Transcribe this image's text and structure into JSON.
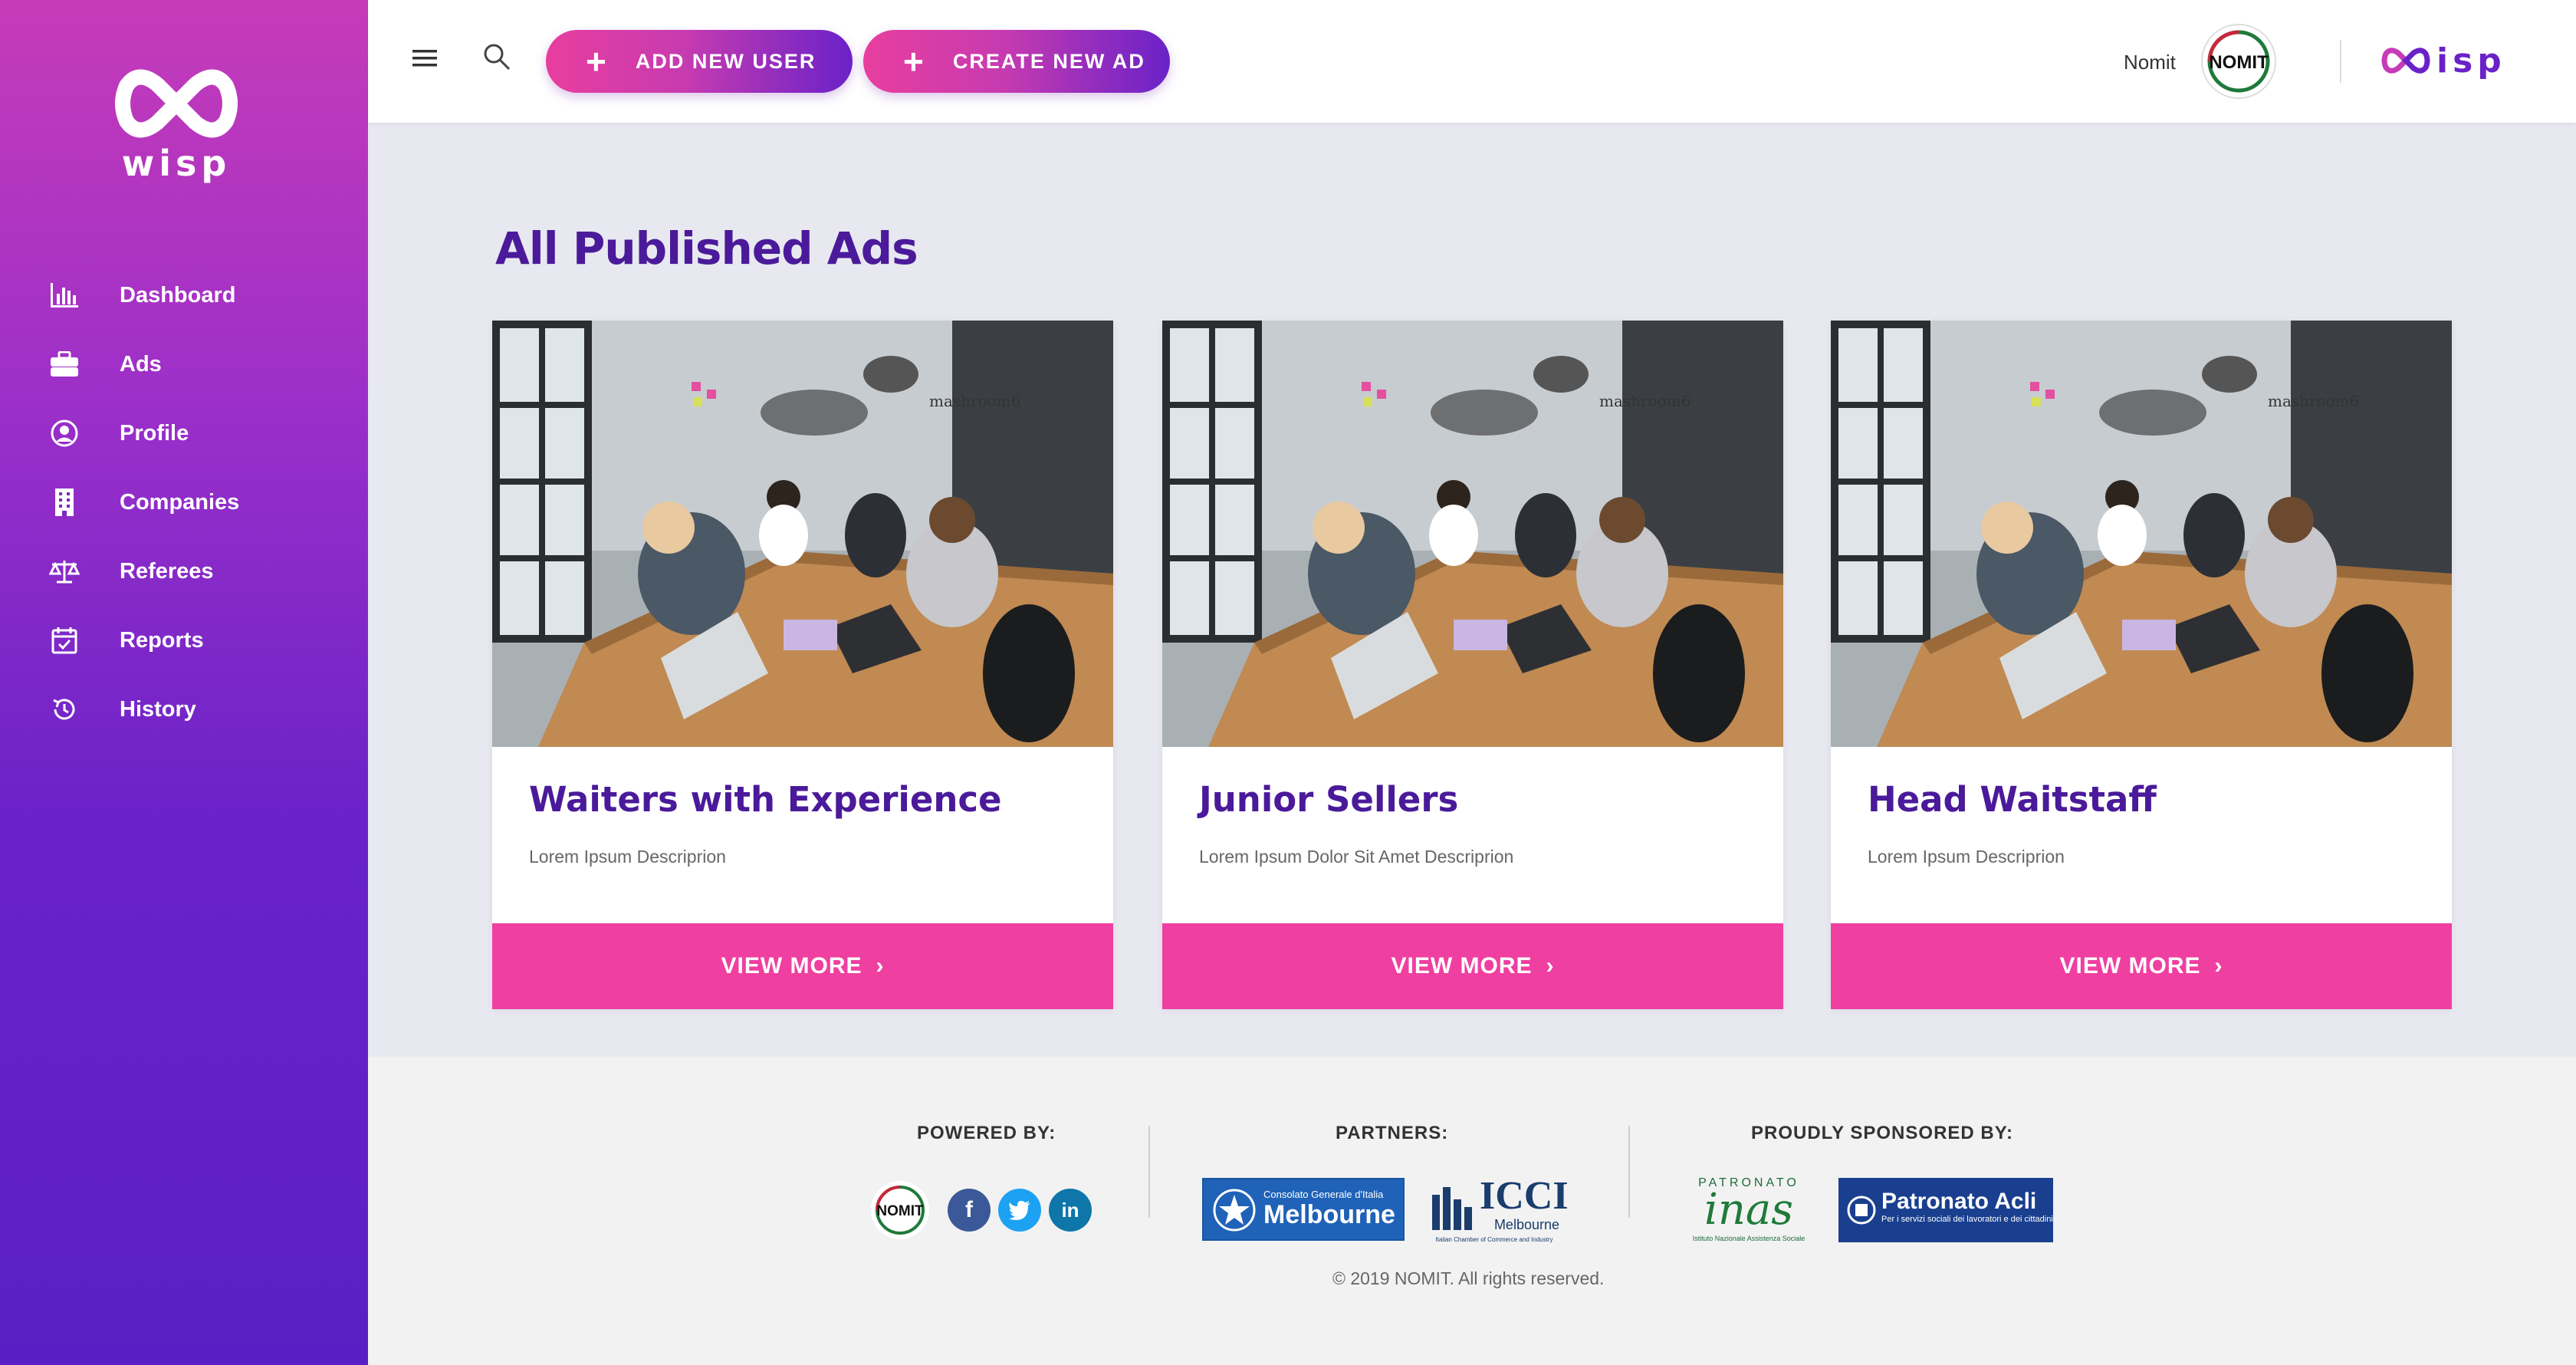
{
  "brand": {
    "name": "wisp"
  },
  "sidebar": {
    "items": [
      {
        "label": "Dashboard",
        "icon": "bar-chart-icon"
      },
      {
        "label": "Ads",
        "icon": "briefcase-icon"
      },
      {
        "label": "Profile",
        "icon": "user-circle-icon"
      },
      {
        "label": "Companies",
        "icon": "building-icon"
      },
      {
        "label": "Referees",
        "icon": "scale-icon"
      },
      {
        "label": "Reports",
        "icon": "calendar-check-icon"
      },
      {
        "label": "History",
        "icon": "history-icon"
      }
    ]
  },
  "topbar": {
    "add_user_label": "ADD NEW USER",
    "create_ad_label": "CREATE NEW AD",
    "user_name": "Nomit",
    "avatar_text": "NOMIT",
    "brand_mini": "isp"
  },
  "main": {
    "title": "All Published Ads",
    "cards": [
      {
        "title": "Waiters with Experience",
        "description": "Lorem Ipsum Descriprion",
        "button": "VIEW MORE"
      },
      {
        "title": "Junior Sellers",
        "description": "Lorem Ipsum Dolor Sit Amet Descriprion",
        "button": "VIEW MORE"
      },
      {
        "title": "Head Waitstaff",
        "description": "Lorem Ipsum Descriprion",
        "button": "VIEW MORE"
      }
    ],
    "photo_sign": "mashroom6"
  },
  "footer": {
    "powered_by": "POWERED BY:",
    "partners": "PARTNERS:",
    "sponsored_by": "PROUDLY SPONSORED BY:",
    "nomit_logo": "NOMIT",
    "social": {
      "facebook": "f",
      "twitter": "t",
      "linkedin": "in"
    },
    "partner_melbourne_small": "Consolato Generale d'Italia",
    "partner_melbourne": "Melbourne",
    "partner_icci": "ICCI",
    "partner_icci_sub": "Melbourne",
    "partner_icci_tag": "Italian Chamber of Commerce and Industry",
    "sponsor_inas_top": "PATRONATO",
    "sponsor_inas": "inas",
    "sponsor_inas_sub": "Istituto Nazionale Assistenza Sociale",
    "sponsor_acli": "Patronato Acli",
    "sponsor_acli_sub": "Per i servizi sociali dei lavoratori e dei cittadini",
    "copyright": "© 2019 NOMIT. All rights reserved."
  },
  "colors": {
    "accent": "#ef3fa1",
    "primary": "#6a22c8",
    "title": "#4a1a9a"
  }
}
